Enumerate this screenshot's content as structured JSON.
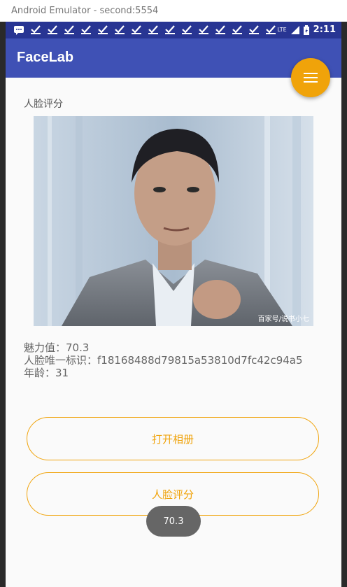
{
  "window": {
    "title": "Android Emulator - second:5554"
  },
  "status_bar": {
    "time": "2:11",
    "network": "LTE",
    "notification_icons": "check-icon"
  },
  "app": {
    "title": "FaceLab"
  },
  "section": {
    "title": "人脸评分"
  },
  "photo": {
    "watermark": "百家号/说书小七"
  },
  "results": {
    "charm": "魅力值：70.3",
    "face_id": "人脸唯一标识：f18168488d79815a53810d7fc42c94a5",
    "age": "年龄：31"
  },
  "buttons": {
    "open_album": "打开相册",
    "face_score": "人脸评分"
  },
  "toast": {
    "text": "70.3"
  },
  "colors": {
    "primary": "#3f51b5",
    "primary_dark": "#283593",
    "accent": "#f0a30a"
  }
}
